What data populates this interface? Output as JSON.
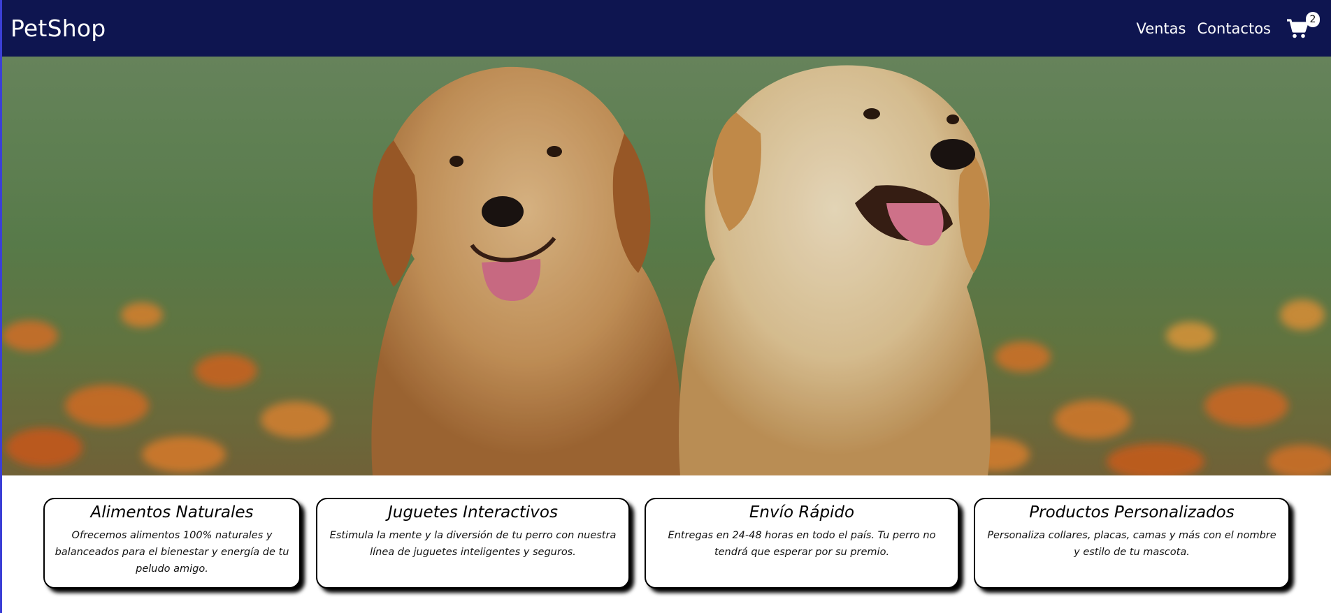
{
  "navbar": {
    "brand": "PetShop",
    "links": [
      "Ventas",
      "Contactos"
    ],
    "cart_icon": "shopping-cart-icon",
    "cart_count": "2"
  },
  "hero": {
    "image": "two golden retriever puppies in a field of orange flowers"
  },
  "features": [
    {
      "title": "Alimentos Naturales",
      "text": "Ofrecemos alimentos 100% naturales y balanceados para el bienestar y energía de tu peludo amigo."
    },
    {
      "title": "Juguetes Interactivos",
      "text": "Estimula la mente y la diversión de tu perro con nuestra línea de juguetes inteligentes y seguros."
    },
    {
      "title": "Envío Rápido",
      "text": "Entregas en 24-48 horas en todo el país. Tu perro no tendrá que esperar por su premio."
    },
    {
      "title": "Productos Personalizados",
      "text": "Personaliza collares, placas, camas y más con el nombre y estilo de tu mascota."
    }
  ],
  "colors": {
    "navbar_bg": "#0e1550",
    "nav_text": "#ffffff",
    "card_border": "#000000"
  }
}
